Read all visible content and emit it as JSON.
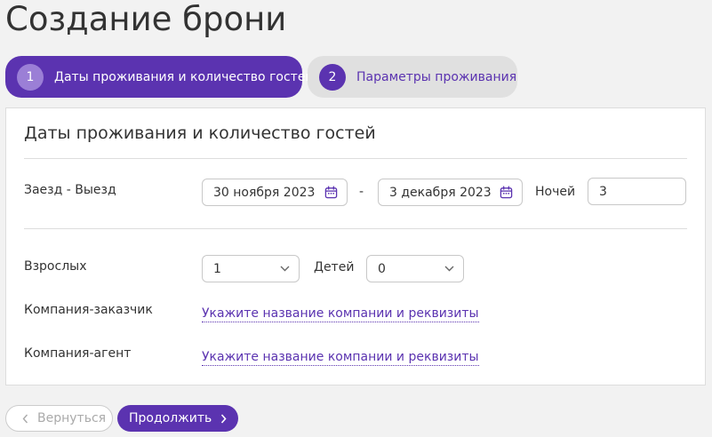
{
  "page": {
    "title": "Создание брони"
  },
  "steps": [
    {
      "number": "1",
      "label": "Даты проживания и количество гостей",
      "active": true
    },
    {
      "number": "2",
      "label": "Параметры проживания",
      "active": false
    }
  ],
  "section": {
    "title": "Даты проживания и количество гостей"
  },
  "dates": {
    "label": "Заезд - Выезд",
    "checkin": "30 ноября 2023",
    "separator": "-",
    "checkout": "3 декабря 2023",
    "nights_label": "Ночей",
    "nights_value": "3"
  },
  "guests": {
    "adults_label": "Взрослых",
    "adults_value": "1",
    "children_label": "Детей",
    "children_value": "0"
  },
  "company": {
    "customer_label": "Компания-заказчик",
    "customer_link": "Укажите название компании и реквизиты",
    "agent_label": "Компания-агент",
    "agent_link": "Укажите название компании и реквизиты"
  },
  "buttons": {
    "back_label": "Вернуться",
    "next_label": "Продолжить"
  },
  "colors": {
    "accent": "#5b33b0",
    "accent_light": "#9b7fd6",
    "inactive_step_bg": "#e0e0e0",
    "background": "#f2f2f2"
  },
  "icons": {
    "date_picker": "calendar-icon",
    "select": "chevron-down-icon",
    "back": "chevron-left-icon",
    "next": "chevron-right-icon"
  }
}
